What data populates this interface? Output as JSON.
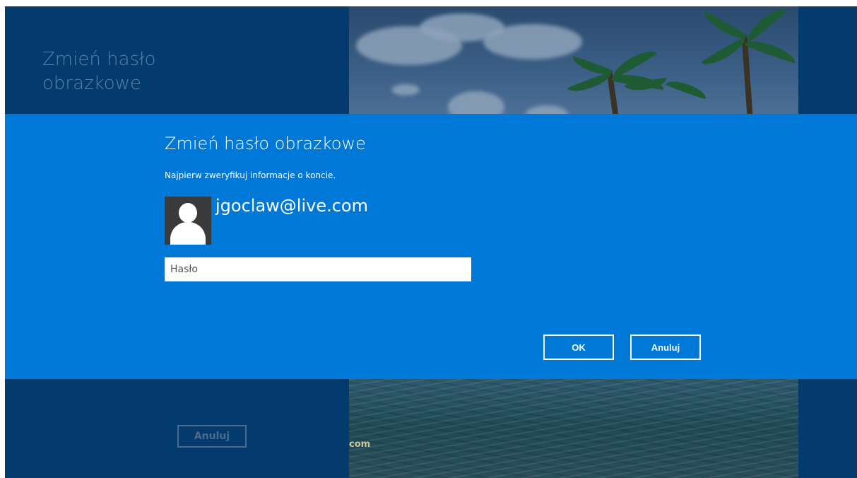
{
  "background": {
    "title": "Zmień hasło obrazkowe",
    "cancel_label": "Anuluj",
    "watermark": "com"
  },
  "dialog": {
    "title": "Zmień hasło obrazkowe",
    "subtitle": "Najpierw zweryfikuj informacje o koncie.",
    "account": "jgoclaw@live.com",
    "password_placeholder": "Hasło",
    "password_value": "",
    "ok_label": "OK",
    "cancel_label": "Anuluj"
  },
  "colors": {
    "dialog_bg": "#0078d7",
    "screen_bg": "#043b6e"
  },
  "icons": {
    "avatar": "user-avatar-icon"
  }
}
